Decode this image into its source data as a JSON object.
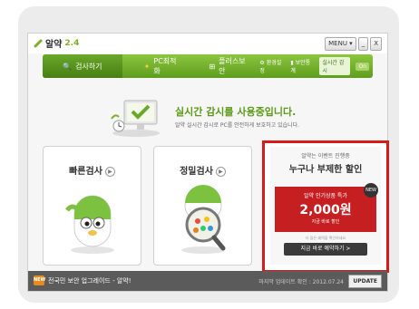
{
  "app": {
    "name": "알약",
    "version": "2.4"
  },
  "window": {
    "menu": "MENU",
    "minimize": "_",
    "close": "X"
  },
  "nav": {
    "items": [
      "검사하기",
      "PC최적화",
      "플러스보안"
    ],
    "env": "환경설정",
    "report": "보안통계",
    "realtime": "실시간 감시",
    "on": "On"
  },
  "status": {
    "title": "실시간 감시를 사용중입니다.",
    "subtitle": "알약 실시간 감시로 PC를 안전하게 보호하고 있습니다."
  },
  "cards": {
    "quick": "빠른검사",
    "deep": "정밀검사"
  },
  "ad": {
    "tag": "알약는 이벤트 진행중",
    "headline": "누구나 부제한 할인",
    "badge": "NEW",
    "box_top": "알약 인기상품 특가",
    "price": "2,000원",
    "box_bottom": "지금 바로 할인",
    "note": "더 많은 혜택을 확인하세요",
    "cta": "지금 바로 예약하기 >"
  },
  "footer": {
    "icon": "NEW",
    "message": "전국민 보안 업그레이드 - 알약!",
    "last_update": "마지막 업데이트 확인 : 2012.07.24",
    "update_button": "UPDATE"
  },
  "colors": {
    "accent": "#6aa82a",
    "ad_red": "#c61f22",
    "frame_red": "#d41c1c"
  }
}
